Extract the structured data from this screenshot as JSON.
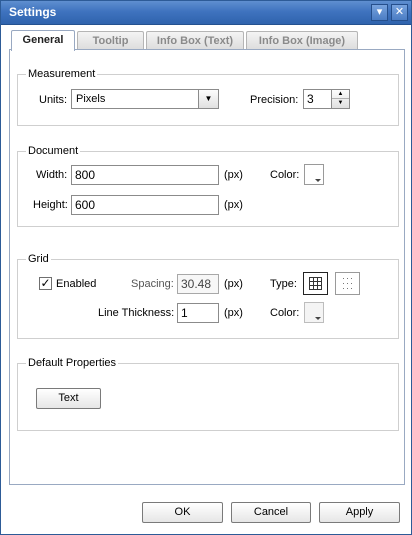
{
  "window": {
    "title": "Settings",
    "minimize_icon": "minimize-icon",
    "close_icon": "close-icon"
  },
  "tabs": [
    {
      "label": "General",
      "active": true
    },
    {
      "label": "Tooltip",
      "active": false
    },
    {
      "label": "Info Box (Text)",
      "active": false
    },
    {
      "label": "Info Box (Image)",
      "active": false
    }
  ],
  "measurement": {
    "legend": "Measurement",
    "units_label": "Units:",
    "units_value": "Pixels",
    "precision_label": "Precision:",
    "precision_value": "3"
  },
  "document": {
    "legend": "Document",
    "width_label": "Width:",
    "width_value": "800",
    "width_unit": "(px)",
    "height_label": "Height:",
    "height_value": "600",
    "height_unit": "(px)",
    "color_label": "Color:",
    "color_value": "#ffffff"
  },
  "grid": {
    "legend": "Grid",
    "enabled_label": "Enabled",
    "enabled_checked": true,
    "spacing_label": "Spacing:",
    "spacing_value": "30.48",
    "spacing_unit": "(px)",
    "type_label": "Type:",
    "types": [
      {
        "icon": "grid-lines-icon",
        "selected": true
      },
      {
        "icon": "grid-dots-icon",
        "selected": false
      }
    ],
    "thickness_label": "Line Thickness:",
    "thickness_value": "1",
    "thickness_unit": "(px)",
    "color_label": "Color:"
  },
  "default_properties": {
    "legend": "Default Properties",
    "text_button": "Text"
  },
  "footer": {
    "ok": "OK",
    "cancel": "Cancel",
    "apply": "Apply"
  }
}
